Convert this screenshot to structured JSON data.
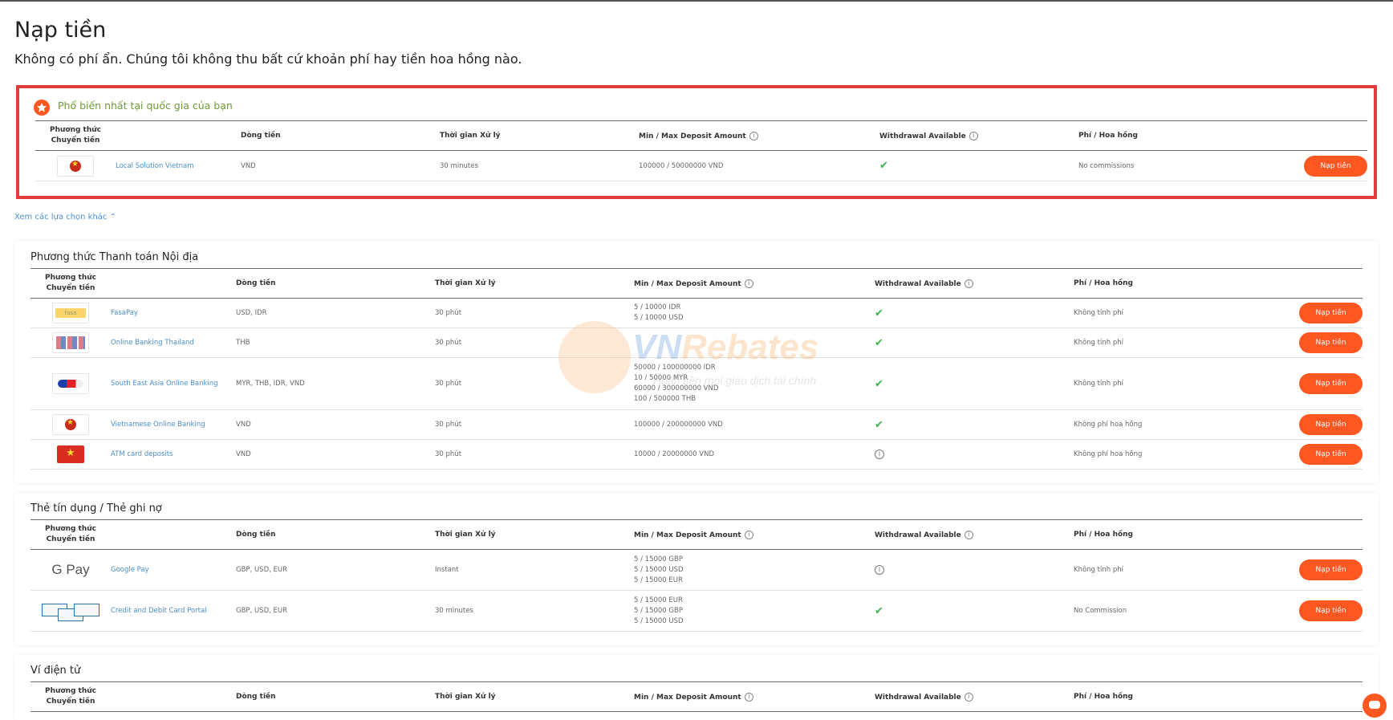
{
  "page": {
    "title": "Nạp tiền",
    "subtitle": "Không có phí ẩn. Chúng tôi không thu bất cứ khoản phí hay tiền hoa hồng nào.",
    "more_link": "Xem các lựa chọn khác"
  },
  "columns": {
    "method": "Phương thức Chuyển tiền",
    "currency": "Dòng tiền",
    "time": "Thời gian Xử lý",
    "minmax": "Min / Max Deposit Amount",
    "withdrawal": "Withdrawal Available",
    "fee": "Phí / Hoa hồng"
  },
  "popular": {
    "title": "Phổ biến nhất tại quốc gia của bạn",
    "rows": [
      {
        "name": "Local Solution Vietnam",
        "currency": "VND",
        "time": "30 minutes",
        "amount": "100000 / 50000000 VND",
        "fee": "No commissions",
        "button": "Nạp tiền"
      }
    ]
  },
  "domestic": {
    "title": "Phương thức Thanh toán Nội địa",
    "rows": [
      {
        "name": "FasaPay",
        "currency": "USD, IDR",
        "time": "30 phút",
        "amount": [
          "5 / 10000 IDR",
          "5 / 10000 USD"
        ],
        "fee": "Không tính phí",
        "button": "Nạp tiền"
      },
      {
        "name": "Online Banking Thailand",
        "currency": "THB",
        "time": "30 phút",
        "amount": [],
        "fee": "Không tính phí",
        "button": "Nạp tiền"
      },
      {
        "name": "South East Asia Online Banking",
        "currency": "MYR, THB, IDR, VND",
        "time": "30 phút",
        "amount": [
          "50000 / 100000000 IDR",
          "10 / 50000 MYR",
          "60000 / 300000000 VND",
          "100 / 500000 THB"
        ],
        "fee": "Không tính phí",
        "button": "Nạp tiền"
      },
      {
        "name": "Vietnamese Online Banking",
        "currency": "VND",
        "time": "30 phút",
        "amount": [
          "100000 / 200000000 VND"
        ],
        "fee": "Không phí hoa hồng",
        "button": "Nạp tiền"
      },
      {
        "name": "ATM card deposits",
        "currency": "VND",
        "time": "30 phút",
        "amount": [
          "10000 / 20000000 VND"
        ],
        "fee": "Không phí hoa hồng",
        "button": "Nạp tiền"
      }
    ]
  },
  "cards": {
    "title": "Thẻ tín dụng / Thẻ ghi nợ",
    "rows": [
      {
        "name": "Google Pay",
        "logo_text": "G Pay",
        "currency": "GBP, USD, EUR",
        "time": "Instant",
        "amount": [
          "5 / 15000 GBP",
          "5 / 15000 USD",
          "5 / 15000 EUR"
        ],
        "fee": "Không tính phí",
        "button": "Nạp tiền"
      },
      {
        "name": "Credit and Debit Card Portal",
        "currency": "GBP, USD, EUR",
        "time": "30 minutes",
        "amount": [
          "5 / 15000 EUR",
          "5 / 15000 GBP",
          "5 / 15000 USD"
        ],
        "fee": "No Commission",
        "button": "Nạp tiền"
      }
    ]
  },
  "ewallet": {
    "title": "Ví điện tử"
  },
  "watermark": {
    "brand_a": "VN",
    "brand_b": "Rebates",
    "tagline": "Hoàn tiền mọi giao dịch tài chính"
  },
  "colors": {
    "accent": "#ff5722",
    "link": "#4b8fc8",
    "highlight_border": "#e03a3a",
    "check": "#3db24b",
    "popular_title": "#6f9a39"
  }
}
